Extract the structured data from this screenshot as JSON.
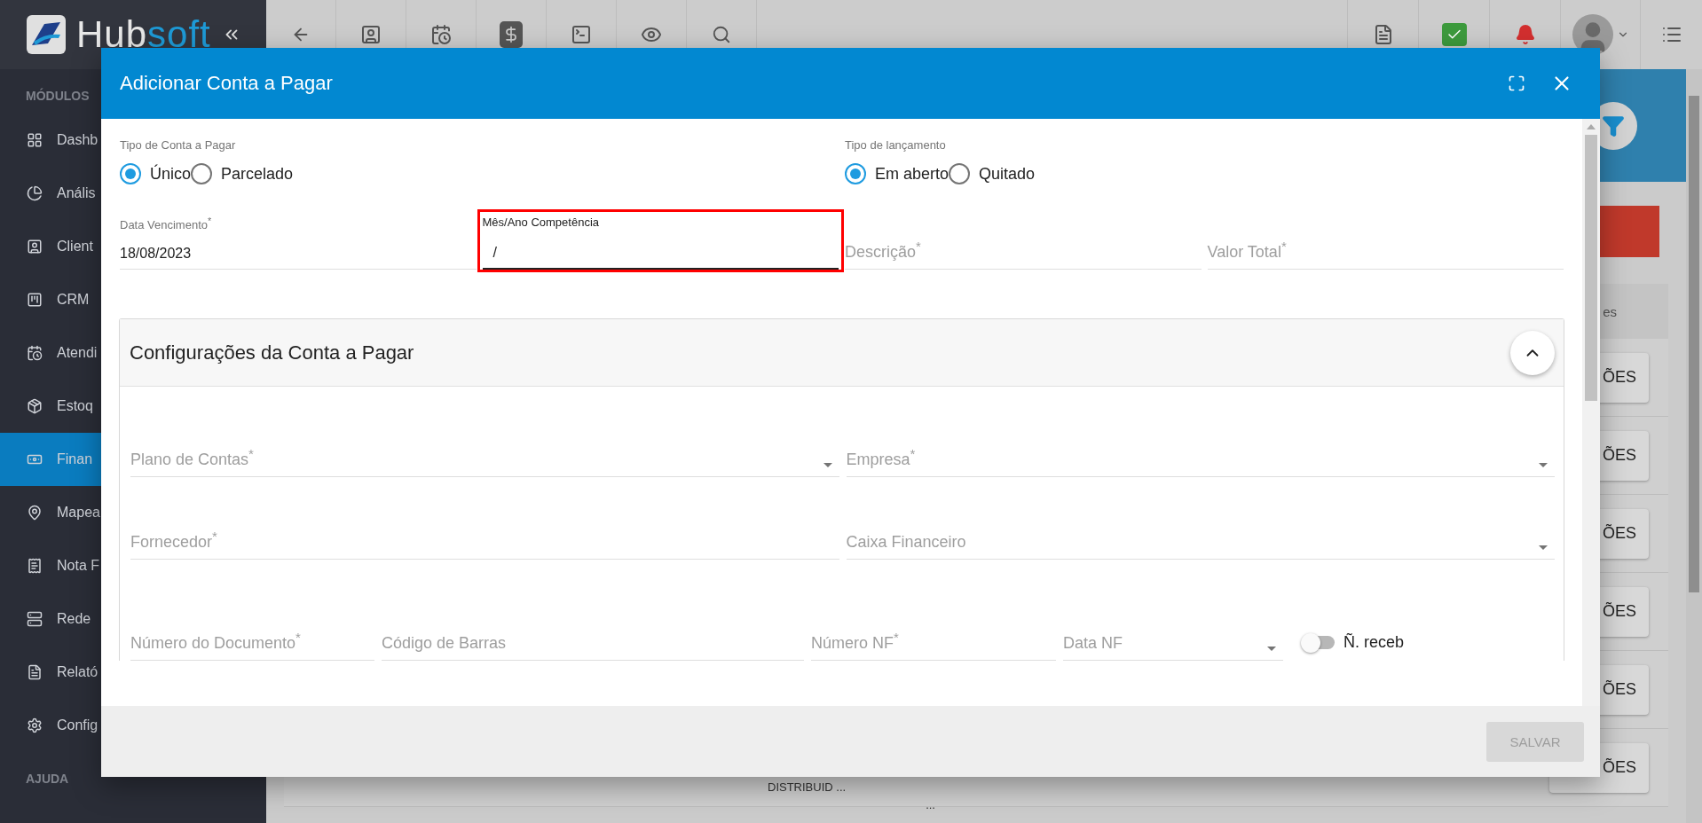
{
  "brand": {
    "name": "Hub",
    "accent": "soft"
  },
  "sidebar": {
    "sections": [
      {
        "heading": "MÓDULOS",
        "items": [
          {
            "label": "Dashb",
            "selected": false
          },
          {
            "label": "Anális",
            "selected": false
          },
          {
            "label": "Client",
            "selected": false
          },
          {
            "label": "CRM",
            "selected": false
          },
          {
            "label": "Atendi",
            "selected": false
          },
          {
            "label": "Estoq",
            "selected": false
          },
          {
            "label": "Finan",
            "selected": true
          },
          {
            "label": "Mapea",
            "selected": false
          },
          {
            "label": "Nota F",
            "selected": false
          },
          {
            "label": "Rede",
            "selected": false
          },
          {
            "label": "Relató",
            "selected": false
          },
          {
            "label": "Config",
            "selected": false
          }
        ]
      },
      {
        "heading": "AJUDA"
      }
    ]
  },
  "background_table": {
    "column_heading": "es",
    "rows": [
      {
        "action": "ÕES"
      },
      {
        "action": "ÕES"
      },
      {
        "action": "ÕES"
      },
      {
        "action": "ÕES"
      },
      {
        "action": "ÕES"
      },
      {
        "action": "ÕES",
        "cells": [
          "DISTRIBUID ...",
          "..."
        ]
      }
    ]
  },
  "modal": {
    "title": "Adicionar Conta a Pagar",
    "radio_groups": [
      {
        "label": "Tipo de Conta a Pagar",
        "options": [
          {
            "label": "Único",
            "selected": true
          },
          {
            "label": "Parcelado",
            "selected": false
          }
        ]
      },
      {
        "label": "Tipo de lançamento",
        "options": [
          {
            "label": "Em aberto",
            "selected": true
          },
          {
            "label": "Quitado",
            "selected": false
          }
        ]
      }
    ],
    "fields": [
      {
        "kind": "text",
        "label": "Data Vencimento$^{*}$",
        "value": "18/08/2023",
        "focused": false,
        "highlighted": false
      },
      {
        "kind": "text",
        "label": "Mês/Ano Competência",
        "value": "/",
        "focused": true,
        "highlighted": true
      },
      {
        "kind": "text",
        "label": "Descrição$^{*}$",
        "focused": false,
        "highlighted": false
      },
      {
        "kind": "text",
        "label": "Valor Total$^{*}$",
        "focused": false,
        "highlighted": false
      }
    ],
    "section": {
      "title": "Configurações da Conta a Pagar",
      "expanded": true,
      "rows": [
        [
          {
            "kind": "select",
            "label": "Plano de Contas$^{*}$"
          },
          {
            "kind": "select",
            "label": "Empresa$^{*}$"
          }
        ],
        [
          {
            "kind": "text",
            "label": "Fornecedor$^{*}$"
          },
          {
            "kind": "select",
            "label": "Caixa Financeiro"
          }
        ],
        [
          {
            "kind": "text",
            "label": "Número do Documento$^{*}$"
          },
          {
            "kind": "text",
            "label": "Código de Barras"
          },
          {
            "kind": "text",
            "label": "Número NF$^{*}$"
          },
          {
            "kind": "select",
            "label": "Data NF"
          },
          {
            "kind": "toggle",
            "label": "Ñ. receb",
            "on": false
          }
        ]
      ]
    },
    "save_button": {
      "label": "SALVAR",
      "disabled": true
    }
  }
}
